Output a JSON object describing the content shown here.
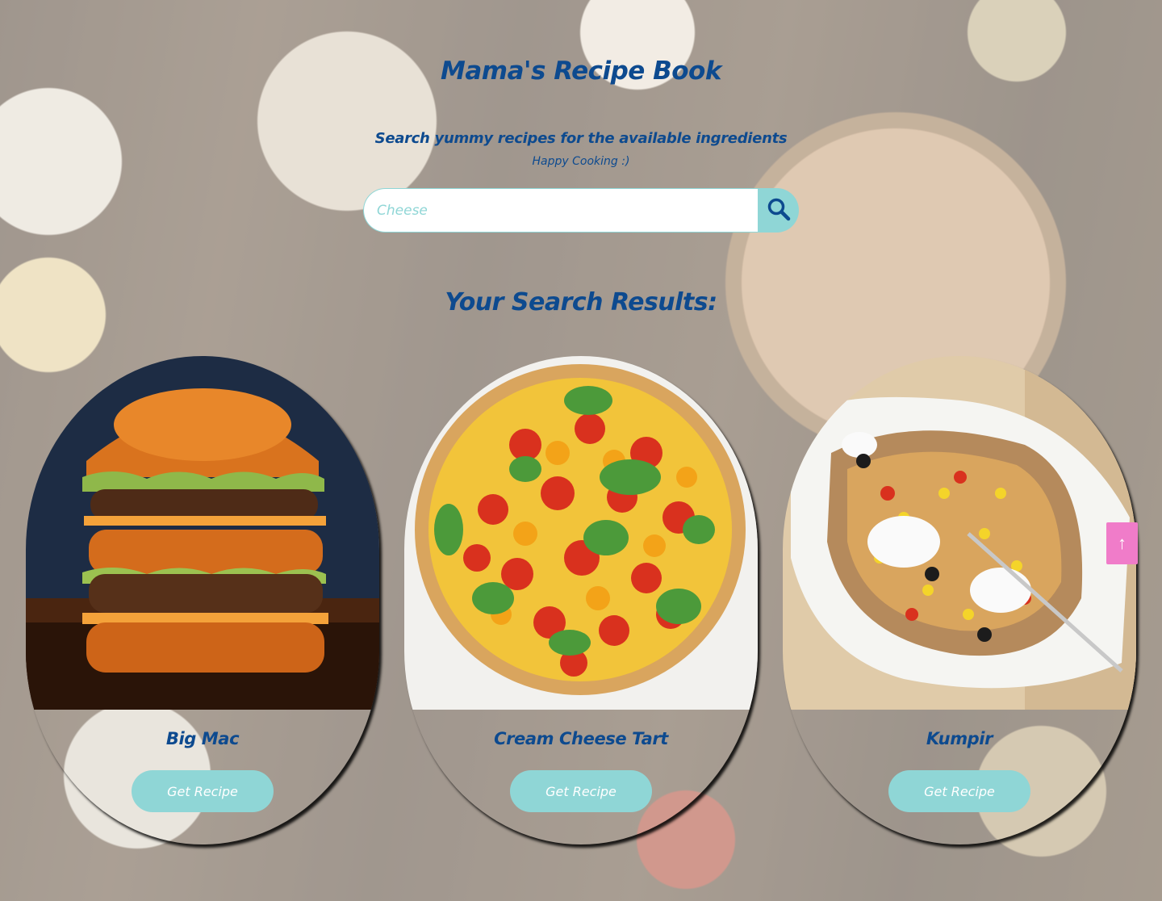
{
  "header": {
    "title": "Mama's Recipe Book",
    "tagline": "Search yummy recipes for the available ingredients",
    "subtagline": "Happy Cooking :)"
  },
  "search": {
    "placeholder": "Cheese",
    "button_icon": "search-icon"
  },
  "results": {
    "heading": "Your Search Results:",
    "cards": [
      {
        "name": "Big Mac",
        "button_label": "Get Recipe",
        "image": "burger-image"
      },
      {
        "name": "Cream Cheese Tart",
        "button_label": "Get Recipe",
        "image": "tomato-tart-image"
      },
      {
        "name": "Kumpir",
        "button_label": "Get Recipe",
        "image": "baked-potato-image"
      }
    ]
  },
  "scroll_top": {
    "label": "↑",
    "icon": "arrow-up-icon"
  },
  "colors": {
    "title": "#0d4a8f",
    "accent": "#8fd6d6",
    "scroll_button": "#f07cc9"
  }
}
